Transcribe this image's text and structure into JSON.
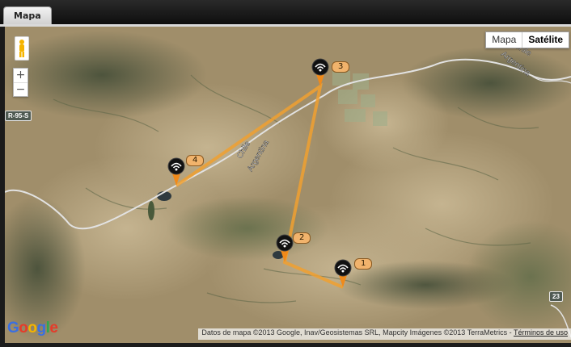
{
  "tab": {
    "label": "Mapa"
  },
  "map_type": {
    "map_label": "Mapa",
    "satellite_label": "Satélite",
    "selected": "Satélite"
  },
  "zoom": {
    "in_label": "+",
    "out_label": "−"
  },
  "road_shields": {
    "r95s": "R-95-S",
    "r23": "23"
  },
  "border_label": {
    "line1": "Chile",
    "line2": "Argentina"
  },
  "markers": [
    {
      "label": "1"
    },
    {
      "label": "2"
    },
    {
      "label": "3"
    },
    {
      "label": "4"
    }
  ],
  "attribution": {
    "text": "Datos de mapa ©2013 Google, Inav/Geosistemas SRL, Mapcity Imágenes ©2013 TerraMetrics",
    "separator": " - ",
    "terms": "Términos de uso"
  },
  "logo": {
    "text": "Google"
  },
  "colors": {
    "route": "#f0a030",
    "marker_body": "#111111",
    "marker_tip": "#f08a1a",
    "label_bg": "#f1b36c",
    "border_line": "#e2e2e2"
  }
}
